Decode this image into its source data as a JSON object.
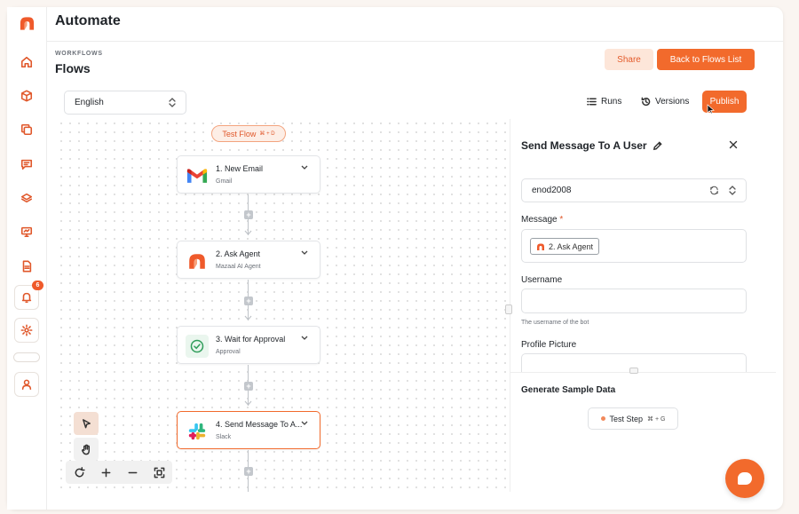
{
  "app": {
    "title": "Automate"
  },
  "breadcrumb": "WORKFLOWS",
  "page_title": "Flows",
  "buttons": {
    "share": "Share",
    "back": "Back to Flows List",
    "publish": "Publish"
  },
  "language": "English",
  "toolbar": {
    "runs": "Runs",
    "versions": "Versions"
  },
  "notification_count": "6",
  "test_flow": {
    "label": "Test Flow",
    "shortcut": "⌘ + D"
  },
  "nodes": [
    {
      "title": "1. New Email",
      "subtitle": "Gmail",
      "icon": "gmail-icon"
    },
    {
      "title": "2. Ask Agent",
      "subtitle": "Mazaal AI Agent",
      "icon": "mazaal-icon"
    },
    {
      "title": "3. Wait for Approval",
      "subtitle": "Approval",
      "icon": "check-circle-icon"
    },
    {
      "title": "4. Send Message To A...",
      "subtitle": "Slack",
      "icon": "slack-icon"
    }
  ],
  "panel": {
    "title": "Send Message To A User",
    "account": "enod2008",
    "message_label": "Message",
    "message_required": "*",
    "message_chip": "2. Ask Agent",
    "username_label": "Username",
    "username_hint": "The username of the bot",
    "profile_label": "Profile Picture",
    "generate_title": "Generate Sample Data",
    "test_step": "Test Step",
    "test_step_shortcut": "⌘ + G"
  },
  "colors": {
    "accent": "#f26a2c",
    "accent_soft": "#fde6d9"
  }
}
